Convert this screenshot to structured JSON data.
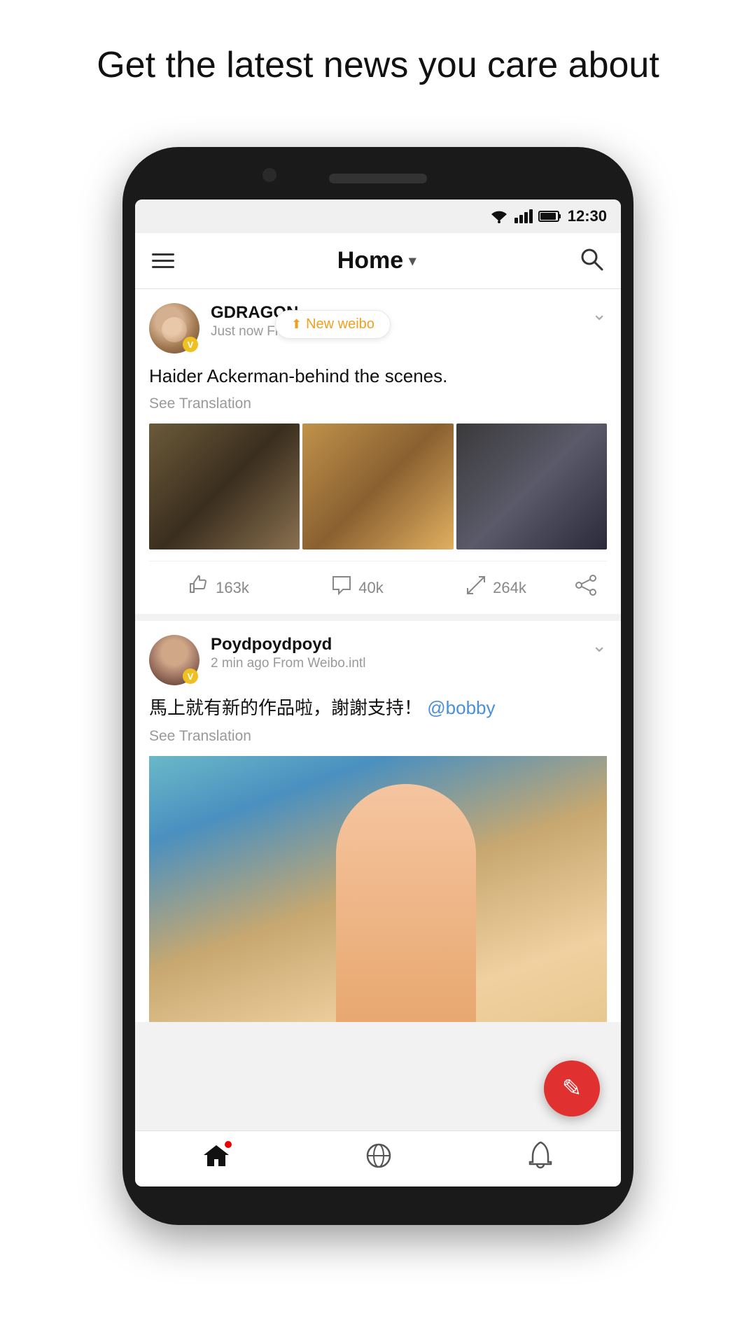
{
  "page": {
    "headline": "Get the latest news you care about"
  },
  "statusBar": {
    "time": "12:30"
  },
  "navBar": {
    "title": "Home",
    "menuIcon": "menu-icon",
    "searchIcon": "search-icon"
  },
  "newWeiboPill": {
    "label": "New weibo"
  },
  "posts": [
    {
      "id": "post-1",
      "username": "GDRAGON",
      "timeAgo": "Just now",
      "source": "Fr...",
      "text": "Haider Ackerman-behind the scenes.",
      "seeTranslation": "See Translation",
      "likes": "163k",
      "comments": "40k",
      "reposts": "264k",
      "imageCount": 3
    },
    {
      "id": "post-2",
      "username": "Poydpoydpoyd",
      "timeAgo": "2 min ago",
      "source": "From Weibo.intl",
      "text": "馬上就有新的作品啦，謝謝支持！",
      "mention": "@bobby",
      "seeTranslation": "See Translation",
      "imageCount": 1
    }
  ],
  "bottomNav": {
    "home": "home-icon",
    "discover": "discover-icon",
    "notifications": "notifications-icon"
  },
  "fab": {
    "icon": "edit-icon"
  }
}
